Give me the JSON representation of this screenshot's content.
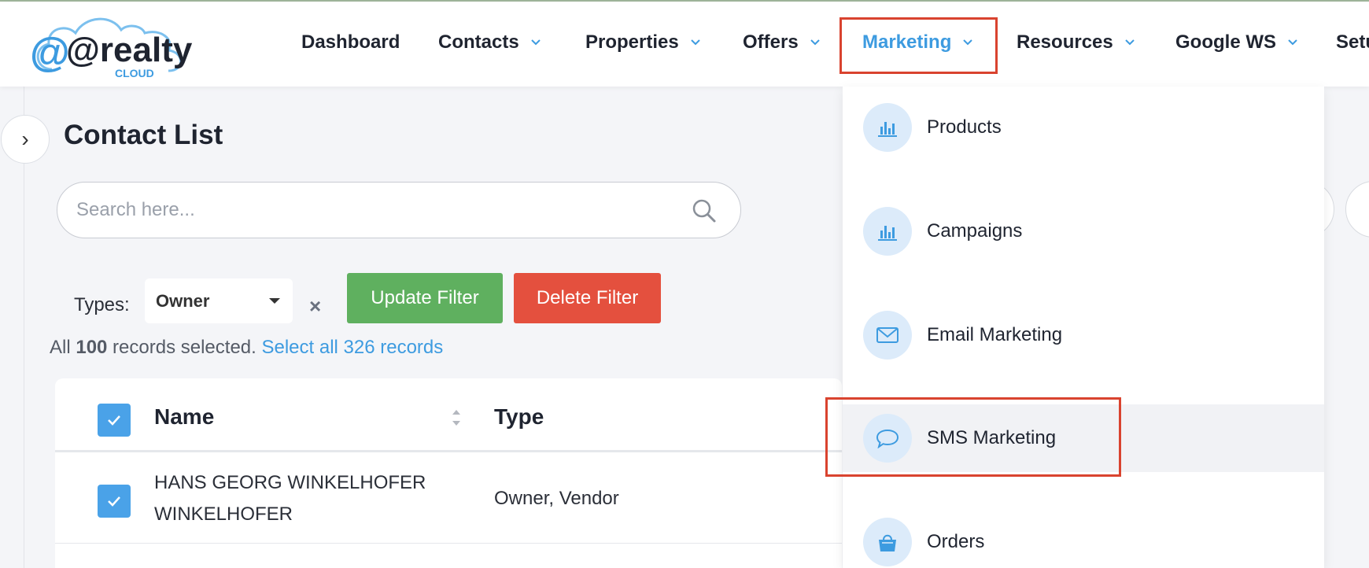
{
  "brand": {
    "logo_main": "@realty",
    "logo_sub": "CLOUD",
    "accent": "#3d9be0",
    "highlight_border": "#d9432f"
  },
  "nav": {
    "items": [
      {
        "label": "Dashboard",
        "has_chevron": false
      },
      {
        "label": "Contacts",
        "has_chevron": true
      },
      {
        "label": "Properties",
        "has_chevron": true
      },
      {
        "label": "Offers",
        "has_chevron": true
      },
      {
        "label": "Marketing",
        "has_chevron": true,
        "active": true
      },
      {
        "label": "Resources",
        "has_chevron": true
      },
      {
        "label": "Google WS",
        "has_chevron": true
      },
      {
        "label": "Setu",
        "has_chevron": false
      }
    ]
  },
  "marketing_menu": {
    "items": [
      {
        "label": "Products",
        "icon": "bar-chart-icon"
      },
      {
        "label": "Campaigns",
        "icon": "bar-chart-icon"
      },
      {
        "label": "Email Marketing",
        "icon": "envelope-icon"
      },
      {
        "label": "SMS Marketing",
        "icon": "chat-bubble-icon",
        "hovered": true
      },
      {
        "label": "Orders",
        "icon": "shopping-bag-icon"
      }
    ]
  },
  "page": {
    "toggle": "›",
    "title": "Contact List"
  },
  "search": {
    "placeholder": "Search here...",
    "value": ""
  },
  "filter": {
    "types_label": "Types:",
    "types_value": "Owner",
    "clear": "×",
    "update_label": "Update Filter",
    "delete_label": "Delete Filter"
  },
  "selection": {
    "prefix": "All ",
    "count": "100",
    "middle": " records selected. ",
    "link": "Select all 326 records"
  },
  "table": {
    "columns": [
      "Name",
      "Type"
    ],
    "rows": [
      {
        "name_line1": "HANS GEORG WINKELHOFER",
        "name_line2": "WINKELHOFER",
        "type": "Owner, Vendor",
        "checked": true
      }
    ]
  },
  "colors": {
    "update_button": "#5fb05f",
    "delete_button": "#e4503e",
    "checkbox": "#4aa2e8"
  }
}
